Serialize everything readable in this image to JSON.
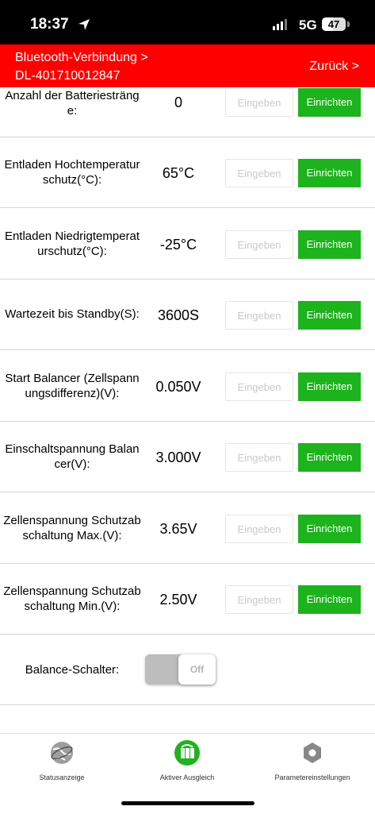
{
  "status_bar": {
    "time": "18:37",
    "network": "5G",
    "battery": "47",
    "battery_level": 0.47
  },
  "header": {
    "bluetooth_line1": "Bluetooth-Verbindung >",
    "bluetooth_line2": "DL-401710012847",
    "back": "Zurück >"
  },
  "settings": [
    {
      "label": "Anzahl der Batteriestränge:",
      "value": "0",
      "input_label": "Eingeben",
      "setup_label": "Einrichten"
    },
    {
      "label": "Entladen Hochtemperaturschutz(°C):",
      "value": "65°C",
      "input_label": "Eingeben",
      "setup_label": "Einrichten"
    },
    {
      "label": "Entladen Niedrigtemperaturschutz(°C):",
      "value": "-25°C",
      "input_label": "Eingeben",
      "setup_label": "Einrichten"
    },
    {
      "label": "Wartezeit bis Standby(S):",
      "value": "3600S",
      "input_label": "Eingeben",
      "setup_label": "Einrichten"
    },
    {
      "label": "Start Balancer (Zellspannungsdifferenz)(V):",
      "value": "0.050V",
      "input_label": "Eingeben",
      "setup_label": "Einrichten"
    },
    {
      "label": "Einschaltspannung Balancer(V):",
      "value": "3.000V",
      "input_label": "Eingeben",
      "setup_label": "Einrichten"
    },
    {
      "label": "Zellenspannung Schutzabschaltung Max.(V):",
      "value": "3.65V",
      "input_label": "Eingeben",
      "setup_label": "Einrichten"
    },
    {
      "label": "Zellenspannung Schutzabschaltung Min.(V):",
      "value": "2.50V",
      "input_label": "Eingeben",
      "setup_label": "Einrichten"
    }
  ],
  "balance_switch": {
    "label": "Balance-Schalter:",
    "state": "Off"
  },
  "tabs": [
    {
      "label": "Statusanzeige",
      "icon": "globe-icon",
      "active": false
    },
    {
      "label": "Aktiver Ausgleich",
      "icon": "battery-balance-icon",
      "active": true
    },
    {
      "label": "Parametereinstellungen",
      "icon": "hexagon-settings-icon",
      "active": false
    }
  ],
  "colors": {
    "header": "#ff0000",
    "accent_green": "#1db31d"
  }
}
